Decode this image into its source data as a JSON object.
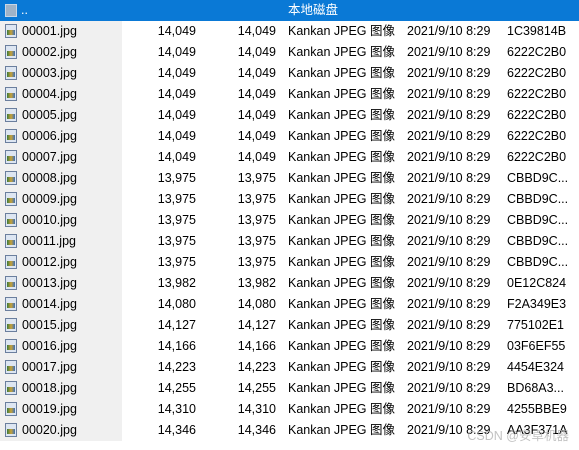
{
  "parent_row": {
    "label": "..",
    "volume_label": "本地磁盘"
  },
  "files": [
    {
      "name": "00001.jpg",
      "size": "14,049",
      "packed": "14,049",
      "type": "Kankan JPEG 图像",
      "modified": "2021/9/10 8:29",
      "crc": "1C39814B"
    },
    {
      "name": "00002.jpg",
      "size": "14,049",
      "packed": "14,049",
      "type": "Kankan JPEG 图像",
      "modified": "2021/9/10 8:29",
      "crc": "6222C2B0"
    },
    {
      "name": "00003.jpg",
      "size": "14,049",
      "packed": "14,049",
      "type": "Kankan JPEG 图像",
      "modified": "2021/9/10 8:29",
      "crc": "6222C2B0"
    },
    {
      "name": "00004.jpg",
      "size": "14,049",
      "packed": "14,049",
      "type": "Kankan JPEG 图像",
      "modified": "2021/9/10 8:29",
      "crc": "6222C2B0"
    },
    {
      "name": "00005.jpg",
      "size": "14,049",
      "packed": "14,049",
      "type": "Kankan JPEG 图像",
      "modified": "2021/9/10 8:29",
      "crc": "6222C2B0"
    },
    {
      "name": "00006.jpg",
      "size": "14,049",
      "packed": "14,049",
      "type": "Kankan JPEG 图像",
      "modified": "2021/9/10 8:29",
      "crc": "6222C2B0"
    },
    {
      "name": "00007.jpg",
      "size": "14,049",
      "packed": "14,049",
      "type": "Kankan JPEG 图像",
      "modified": "2021/9/10 8:29",
      "crc": "6222C2B0"
    },
    {
      "name": "00008.jpg",
      "size": "13,975",
      "packed": "13,975",
      "type": "Kankan JPEG 图像",
      "modified": "2021/9/10 8:29",
      "crc": "CBBD9C..."
    },
    {
      "name": "00009.jpg",
      "size": "13,975",
      "packed": "13,975",
      "type": "Kankan JPEG 图像",
      "modified": "2021/9/10 8:29",
      "crc": "CBBD9C..."
    },
    {
      "name": "00010.jpg",
      "size": "13,975",
      "packed": "13,975",
      "type": "Kankan JPEG 图像",
      "modified": "2021/9/10 8:29",
      "crc": "CBBD9C..."
    },
    {
      "name": "00011.jpg",
      "size": "13,975",
      "packed": "13,975",
      "type": "Kankan JPEG 图像",
      "modified": "2021/9/10 8:29",
      "crc": "CBBD9C..."
    },
    {
      "name": "00012.jpg",
      "size": "13,975",
      "packed": "13,975",
      "type": "Kankan JPEG 图像",
      "modified": "2021/9/10 8:29",
      "crc": "CBBD9C..."
    },
    {
      "name": "00013.jpg",
      "size": "13,982",
      "packed": "13,982",
      "type": "Kankan JPEG 图像",
      "modified": "2021/9/10 8:29",
      "crc": "0E12C824"
    },
    {
      "name": "00014.jpg",
      "size": "14,080",
      "packed": "14,080",
      "type": "Kankan JPEG 图像",
      "modified": "2021/9/10 8:29",
      "crc": "F2A349E3"
    },
    {
      "name": "00015.jpg",
      "size": "14,127",
      "packed": "14,127",
      "type": "Kankan JPEG 图像",
      "modified": "2021/9/10 8:29",
      "crc": "775102E1"
    },
    {
      "name": "00016.jpg",
      "size": "14,166",
      "packed": "14,166",
      "type": "Kankan JPEG 图像",
      "modified": "2021/9/10 8:29",
      "crc": "03F6EF55"
    },
    {
      "name": "00017.jpg",
      "size": "14,223",
      "packed": "14,223",
      "type": "Kankan JPEG 图像",
      "modified": "2021/9/10 8:29",
      "crc": "4454E324"
    },
    {
      "name": "00018.jpg",
      "size": "14,255",
      "packed": "14,255",
      "type": "Kankan JPEG 图像",
      "modified": "2021/9/10 8:29",
      "crc": "BD68A3..."
    },
    {
      "name": "00019.jpg",
      "size": "14,310",
      "packed": "14,310",
      "type": "Kankan JPEG 图像",
      "modified": "2021/9/10 8:29",
      "crc": "4255BBE9"
    },
    {
      "name": "00020.jpg",
      "size": "14,346",
      "packed": "14,346",
      "type": "Kankan JPEG 图像",
      "modified": "2021/9/10 8:29",
      "crc": "AA3F371A"
    }
  ],
  "watermark": "CSDN @安卓机器",
  "colors": {
    "selection": "#0a79d6",
    "name_column_bg": "#f0f0f0"
  }
}
